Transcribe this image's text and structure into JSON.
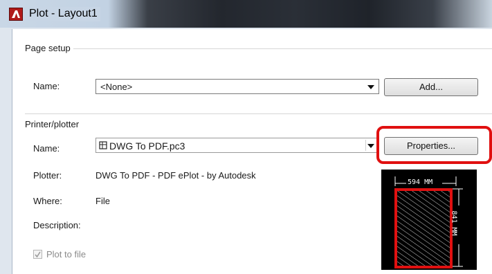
{
  "window": {
    "title": "Plot - Layout1"
  },
  "page_setup": {
    "group_label": "Page setup",
    "name_label": "Name:",
    "name_value": "<None>",
    "add_button": "Add..."
  },
  "printer": {
    "group_label": "Printer/plotter",
    "name_label": "Name:",
    "name_value": "DWG To PDF.pc3",
    "properties_button": "Properties...",
    "plotter_label": "Plotter:",
    "plotter_value": "DWG To PDF - PDF ePlot - by Autodesk",
    "where_label": "Where:",
    "where_value": "File",
    "description_label": "Description:",
    "plot_to_file_label": "Plot to file",
    "plot_to_file_checked": true
  },
  "preview": {
    "width_label": "594 MM",
    "height_label": "841 MM"
  },
  "colors": {
    "highlight": "#e01010",
    "title_bar_dark": "#23272e"
  }
}
